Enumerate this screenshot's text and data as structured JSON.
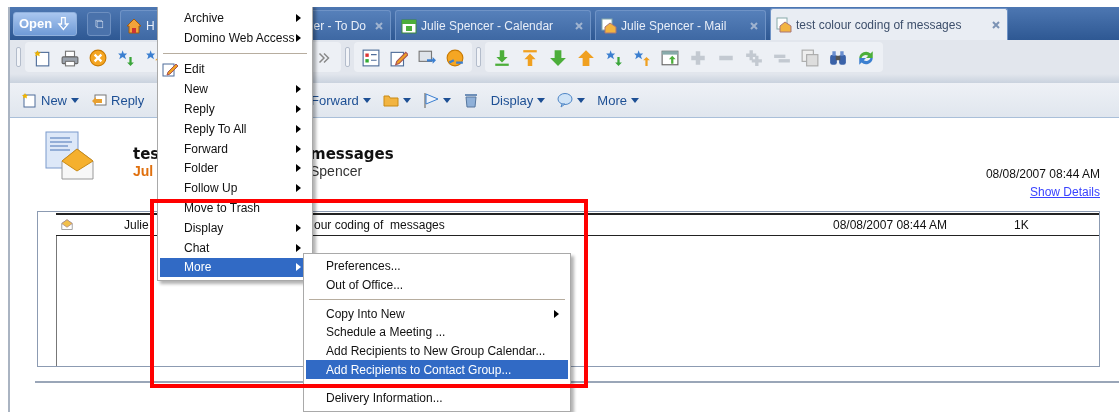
{
  "tab_bar": {
    "open_button": "Open",
    "tabs": [
      {
        "label": "H",
        "selected": false
      },
      {
        "label": "er - To Do",
        "selected": false
      },
      {
        "label": "Julie Spencer - Calendar",
        "selected": false
      },
      {
        "label": "Julie Spencer - Mail",
        "selected": false
      },
      {
        "label": "test colour coding of messages",
        "selected": true
      }
    ]
  },
  "action_bar": {
    "items": [
      {
        "label": "New"
      },
      {
        "label": "Reply"
      },
      {
        "label": "Forward"
      },
      {
        "label": "Display"
      },
      {
        "label": "More"
      }
    ]
  },
  "message": {
    "title_parts": [
      "tes",
      "messages"
    ],
    "sender_parts": [
      "Jul",
      "Spencer"
    ],
    "date": "08/08/2007 08:44 AM",
    "show_details": "Show Details"
  },
  "message_list": {
    "rows": [
      {
        "from": "Julie",
        "subject": "our coding of  messages",
        "date": "08/08/2007 08:44 AM",
        "size": "1K"
      }
    ]
  },
  "context_menu": {
    "items": [
      {
        "kind": "item",
        "label": "Archive",
        "submenu": true,
        "selected": false
      },
      {
        "kind": "item",
        "label": "Domino Web Access",
        "submenu": true,
        "selected": false
      },
      {
        "kind": "separator"
      },
      {
        "kind": "icon_item",
        "label": "Edit",
        "submenu": false,
        "selected": false
      },
      {
        "kind": "item",
        "label": "New",
        "submenu": true,
        "selected": false
      },
      {
        "kind": "item",
        "label": "Reply",
        "submenu": true,
        "selected": false
      },
      {
        "kind": "item",
        "label": "Reply To All",
        "submenu": true,
        "selected": false
      },
      {
        "kind": "item",
        "label": "Forward",
        "submenu": true,
        "selected": false
      },
      {
        "kind": "item",
        "label": "Folder",
        "submenu": true,
        "selected": false
      },
      {
        "kind": "item",
        "label": "Follow Up",
        "submenu": true,
        "selected": false
      },
      {
        "kind": "item",
        "label": "Move to Trash",
        "submenu": false,
        "selected": false
      },
      {
        "kind": "item",
        "label": "Display",
        "submenu": true,
        "selected": false
      },
      {
        "kind": "item",
        "label": "Chat",
        "submenu": true,
        "selected": false
      },
      {
        "kind": "item",
        "label": "More",
        "submenu": true,
        "selected": true
      }
    ]
  },
  "more_submenu": {
    "items": [
      {
        "kind": "item",
        "label": "Preferences...",
        "submenu": false,
        "selected": false
      },
      {
        "kind": "item",
        "label": "Out of Office...",
        "submenu": false,
        "selected": false
      },
      {
        "kind": "separator"
      },
      {
        "kind": "item",
        "label": "Copy Into New",
        "submenu": true,
        "selected": false
      },
      {
        "kind": "item",
        "label": "Schedule a Meeting ...",
        "submenu": false,
        "selected": false
      },
      {
        "kind": "item",
        "label": "Add Recipients to New Group Calendar...",
        "submenu": false,
        "selected": false
      },
      {
        "kind": "item",
        "label": "Add Recipients to Contact Group...",
        "submenu": false,
        "selected": true
      },
      {
        "kind": "separator"
      },
      {
        "kind": "item",
        "label": "Delivery Information...",
        "submenu": false,
        "selected": false
      }
    ]
  }
}
